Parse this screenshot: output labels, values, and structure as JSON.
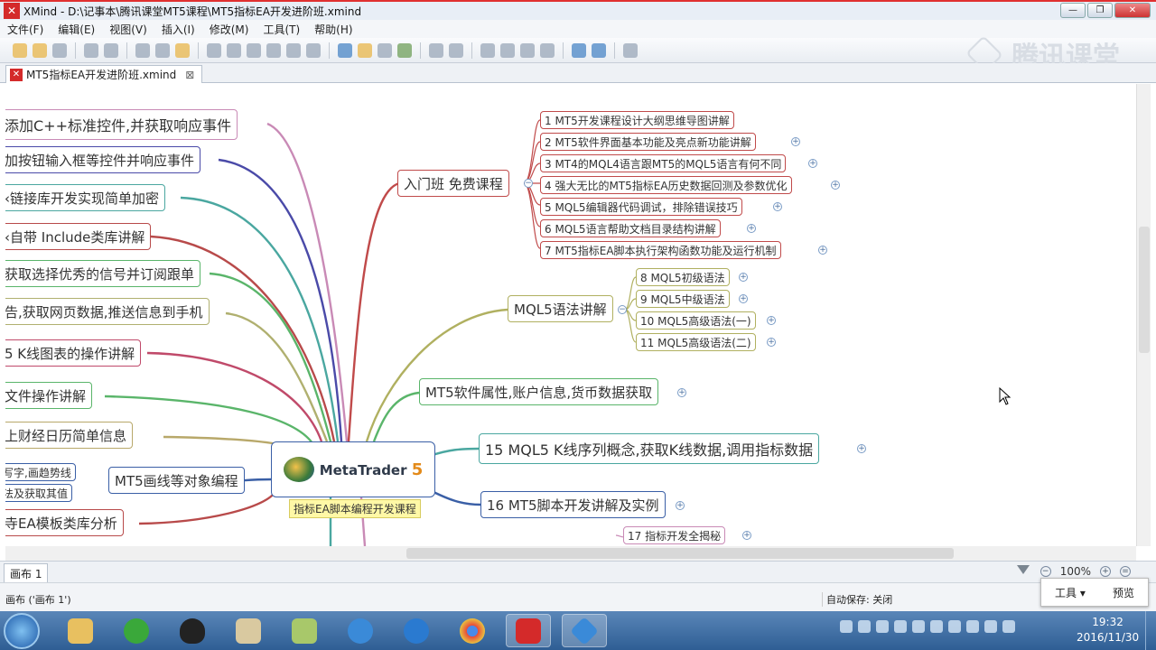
{
  "window": {
    "title": "XMind - D:\\记事本\\腾讯课堂MT5课程\\MT5指标EA开发进阶班.xmind"
  },
  "menu": [
    "文件(F)",
    "编辑(E)",
    "视图(V)",
    "插入(I)",
    "修改(M)",
    "工具(T)",
    "帮助(H)"
  ],
  "watermark": "腾讯课堂",
  "tab": {
    "label": "MT5指标EA开发进阶班.xmind",
    "close": "⊠"
  },
  "central": {
    "title": "MetaTrader",
    "version": "5",
    "label": "指标EA脚本编程开发课程"
  },
  "left_topics": [
    "添加C++标准控件,并获取响应事件",
    "加按钮输入框等控件并响应事件",
    "‹链接库开发实现简单加密",
    "‹自带 Include类库讲解",
    "获取选择优秀的信号并订阅跟单",
    "告,获取网页数据,推送信息到手机",
    "5 K线图表的操作讲解",
    "文件操作讲解",
    "上财经日历简单信息",
    "MT5画线等对象编程",
    "寺EA模板类库分析"
  ],
  "left_sub": [
    "写字,画趋势线",
    "法及获取其值"
  ],
  "branches": {
    "intro": {
      "title": "入门班 免费课程",
      "items": [
        "1 MT5开发课程设计大纲思维导图讲解",
        "2 MT5软件界面基本功能及亮点新功能讲解",
        "3 MT4的MQL4语言跟MT5的MQL5语言有何不同",
        "4 强大无比的MT5指标EA历史数据回测及参数优化",
        "5 MQL5编辑器代码调试，排除错误技巧",
        "6 MQL5语言帮助文档目录结构讲解",
        "7 MT5指标EA脚本执行架构函数功能及运行机制"
      ]
    },
    "mql5": {
      "title": "MQL5语法讲解",
      "items": [
        "8 MQL5初级语法",
        "9 MQL5中级语法",
        "10 MQL5高级语法(一)",
        "11 MQL5高级语法(二)"
      ]
    },
    "account": "MT5软件属性,账户信息,货币数据获取",
    "kline": "15 MQL5 K线序列概念,获取K线数据,调用指标数据",
    "script": "16 MT5脚本开发讲解及实例",
    "indicator": "17 指标开发全揭秘"
  },
  "sheet": {
    "tab": "画布 1",
    "zoom": "100%"
  },
  "status": {
    "left": "画布 ('画布 1')",
    "autosave": "自动保存: 关闭"
  },
  "popup": {
    "tools": "工具 ▾",
    "preview": "预览"
  },
  "clock": {
    "time": "19:32",
    "date": "2016/11/30"
  },
  "colors": {
    "center_border": "#3a5fa6",
    "accent_red": "#d42a2a",
    "taskbar": "#3a6aa4"
  }
}
